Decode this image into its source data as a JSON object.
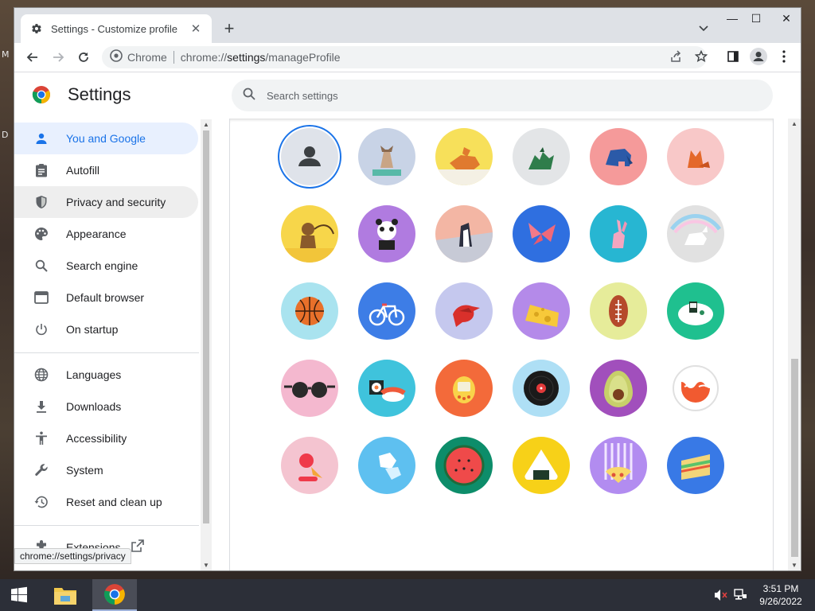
{
  "desktop": {
    "left_fragments": [
      "M",
      "D"
    ]
  },
  "window": {
    "tab": {
      "title": "Settings - Customize profile",
      "close_icon": "close-icon"
    },
    "new_tab_label": "+",
    "controls": {
      "minimize": "—",
      "maximize": "☐",
      "close": "✕"
    }
  },
  "toolbar": {
    "site_label": "Chrome",
    "url_prefix": "chrome://",
    "url_main": "settings",
    "url_suffix": "/manageProfile"
  },
  "settings": {
    "title": "Settings",
    "search_placeholder": "Search settings"
  },
  "sidebar": {
    "items": [
      {
        "label": "You and Google",
        "icon": "person-icon"
      },
      {
        "label": "Autofill",
        "icon": "clipboard-icon"
      },
      {
        "label": "Privacy and security",
        "icon": "shield-icon"
      },
      {
        "label": "Appearance",
        "icon": "palette-icon"
      },
      {
        "label": "Search engine",
        "icon": "search-icon"
      },
      {
        "label": "Default browser",
        "icon": "browser-icon"
      },
      {
        "label": "On startup",
        "icon": "power-icon"
      },
      {
        "label": "Languages",
        "icon": "globe-icon"
      },
      {
        "label": "Downloads",
        "icon": "download-icon"
      },
      {
        "label": "Accessibility",
        "icon": "accessibility-icon"
      },
      {
        "label": "System",
        "icon": "wrench-icon"
      },
      {
        "label": "Reset and clean up",
        "icon": "history-icon"
      },
      {
        "label": "Extensions",
        "icon": "puzzle-icon"
      }
    ]
  },
  "status_bar": {
    "url": "chrome://settings/privacy"
  },
  "avatars": [
    {
      "name": "generic-person",
      "bg": "#dfe3ea"
    },
    {
      "name": "cat",
      "bg": "#c8d3e6"
    },
    {
      "name": "corgi",
      "bg": "#f7e05a"
    },
    {
      "name": "dragon",
      "bg": "#e3e5e7"
    },
    {
      "name": "elephant",
      "bg": "#f59a9a"
    },
    {
      "name": "fox",
      "bg": "#f8c8c8"
    },
    {
      "name": "monkey",
      "bg": "#f7d64a"
    },
    {
      "name": "panda",
      "bg": "#b07be0"
    },
    {
      "name": "penguin",
      "bg": "#f3b6a4"
    },
    {
      "name": "butterfly",
      "bg": "#2f6fe0"
    },
    {
      "name": "rabbit",
      "bg": "#27b6d2"
    },
    {
      "name": "unicorn",
      "bg": "#e1e1e1"
    },
    {
      "name": "basketball",
      "bg": "#a9e3ef"
    },
    {
      "name": "bicycle",
      "bg": "#3d7de6"
    },
    {
      "name": "bird",
      "bg": "#c5c8ee"
    },
    {
      "name": "cheese",
      "bg": "#b48ae9"
    },
    {
      "name": "football",
      "bg": "#e6ec9a"
    },
    {
      "name": "sushi-plate",
      "bg": "#1fc08f"
    },
    {
      "name": "sunglasses",
      "bg": "#f4b8cf"
    },
    {
      "name": "sushi-roll",
      "bg": "#3fc3dc"
    },
    {
      "name": "tamagotchi",
      "bg": "#f36a3a"
    },
    {
      "name": "vinyl",
      "bg": "#aedff5"
    },
    {
      "name": "avocado",
      "bg": "#a14fbc"
    },
    {
      "name": "cloud-app",
      "bg": "#ffffff"
    },
    {
      "name": "ice-cream",
      "bg": "#f4c4d0"
    },
    {
      "name": "ice",
      "bg": "#5ec0f0"
    },
    {
      "name": "watermelon",
      "bg": "#0d8d6a"
    },
    {
      "name": "onigiri",
      "bg": "#f7d118"
    },
    {
      "name": "pizza",
      "bg": "#b28cf0"
    },
    {
      "name": "sandwich",
      "bg": "#3879e6"
    }
  ],
  "taskbar": {
    "clock_time": "3:51 PM",
    "clock_date": "9/26/2022"
  }
}
